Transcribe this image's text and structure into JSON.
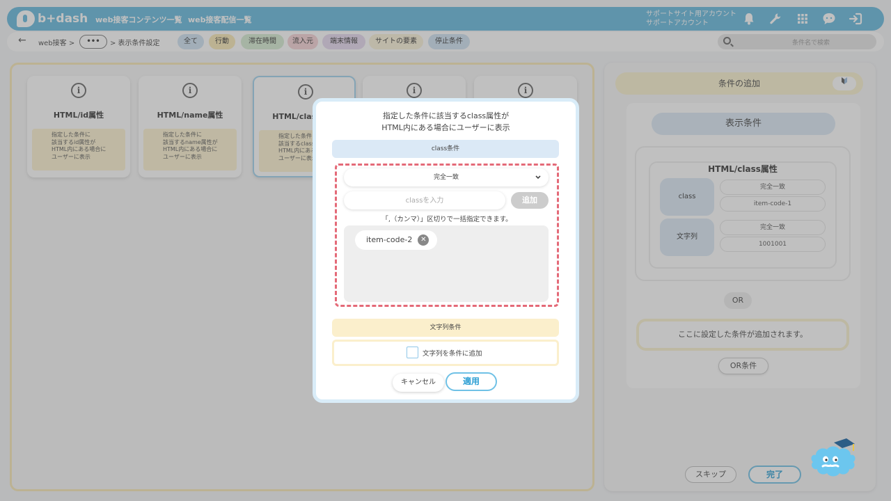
{
  "header": {
    "logo_text": "b+dash",
    "nav": [
      "web接客コンテンツ一覧",
      "web接客配信一覧"
    ],
    "account_lines": [
      "サポートサイト用アカウント",
      "サポートアカウント"
    ],
    "icons": [
      "bell-icon",
      "wrench-icon",
      "grid-icon",
      "chat-icon",
      "logout-icon"
    ]
  },
  "breadcrumb": {
    "root": "web接客 >",
    "more": "•••",
    "current": "> 表示条件設定"
  },
  "filter_tabs": [
    {
      "label": "全て",
      "color": "#cfe2f3"
    },
    {
      "label": "行動",
      "color": "#f8e9b5"
    },
    {
      "label": "滞在時間",
      "color": "#d6ecd2"
    },
    {
      "label": "流入元",
      "color": "#f6d2d6"
    },
    {
      "label": "端末情報",
      "color": "#e6d9ef"
    },
    {
      "label": "サイトの要素",
      "color": "#fbf2d9"
    },
    {
      "label": "停止条件",
      "color": "#cfe2f3"
    }
  ],
  "search": {
    "placeholder": "条件名で検索"
  },
  "cards": [
    {
      "title": "HTML/id属性",
      "desc": "指定した条件に\n該当するid属性が\nHTML内にある場合に\nユーザーに表示"
    },
    {
      "title": "HTML/name属性",
      "desc": "指定した条件に\n該当するname属性が\nHTML内にある場合に\nユーザーに表示"
    },
    {
      "title": "HTML/class属性",
      "desc": "指定した条件に\n該当するclass属性が\nHTML内にある場合に\nユーザーに表示"
    },
    {
      "title": "",
      "desc": ""
    },
    {
      "title": "",
      "desc": ""
    }
  ],
  "right_panel": {
    "add_condition": "条件の追加",
    "add_condition_icon": "beginner-mark-icon",
    "display_condition": "表示条件",
    "condition_title": "HTML/class属性",
    "rows": [
      {
        "label": "class",
        "match": "完全一致",
        "value": "item-code-1"
      },
      {
        "label": "文字列",
        "match": "完全一致",
        "value": "1001001"
      }
    ],
    "or_label": "OR",
    "placeholder": "ここに設定した条件が追加されます。",
    "or_condition_button": "OR条件",
    "skip_button": "スキップ",
    "done_button": "完了"
  },
  "modal": {
    "title_line1": "指定した条件に該当するclass属性が",
    "title_line2": "HTML内にある場合にユーザーに表示",
    "class_section": "class条件",
    "match_select": "完全一致",
    "input_placeholder": "classを入力",
    "add_button": "追加",
    "hint": "「,（カンマ）」区切りで一括指定できます。",
    "tags": [
      "item-code-2"
    ],
    "string_section": "文字列条件",
    "string_checkbox_label": "文字列を条件に追加",
    "cancel_button": "キャンセル",
    "apply_button": "適用"
  },
  "colors": {
    "brand": "#63b8dd",
    "accent_border": "#6fc1e6",
    "dashed_highlight": "#e46a78"
  }
}
